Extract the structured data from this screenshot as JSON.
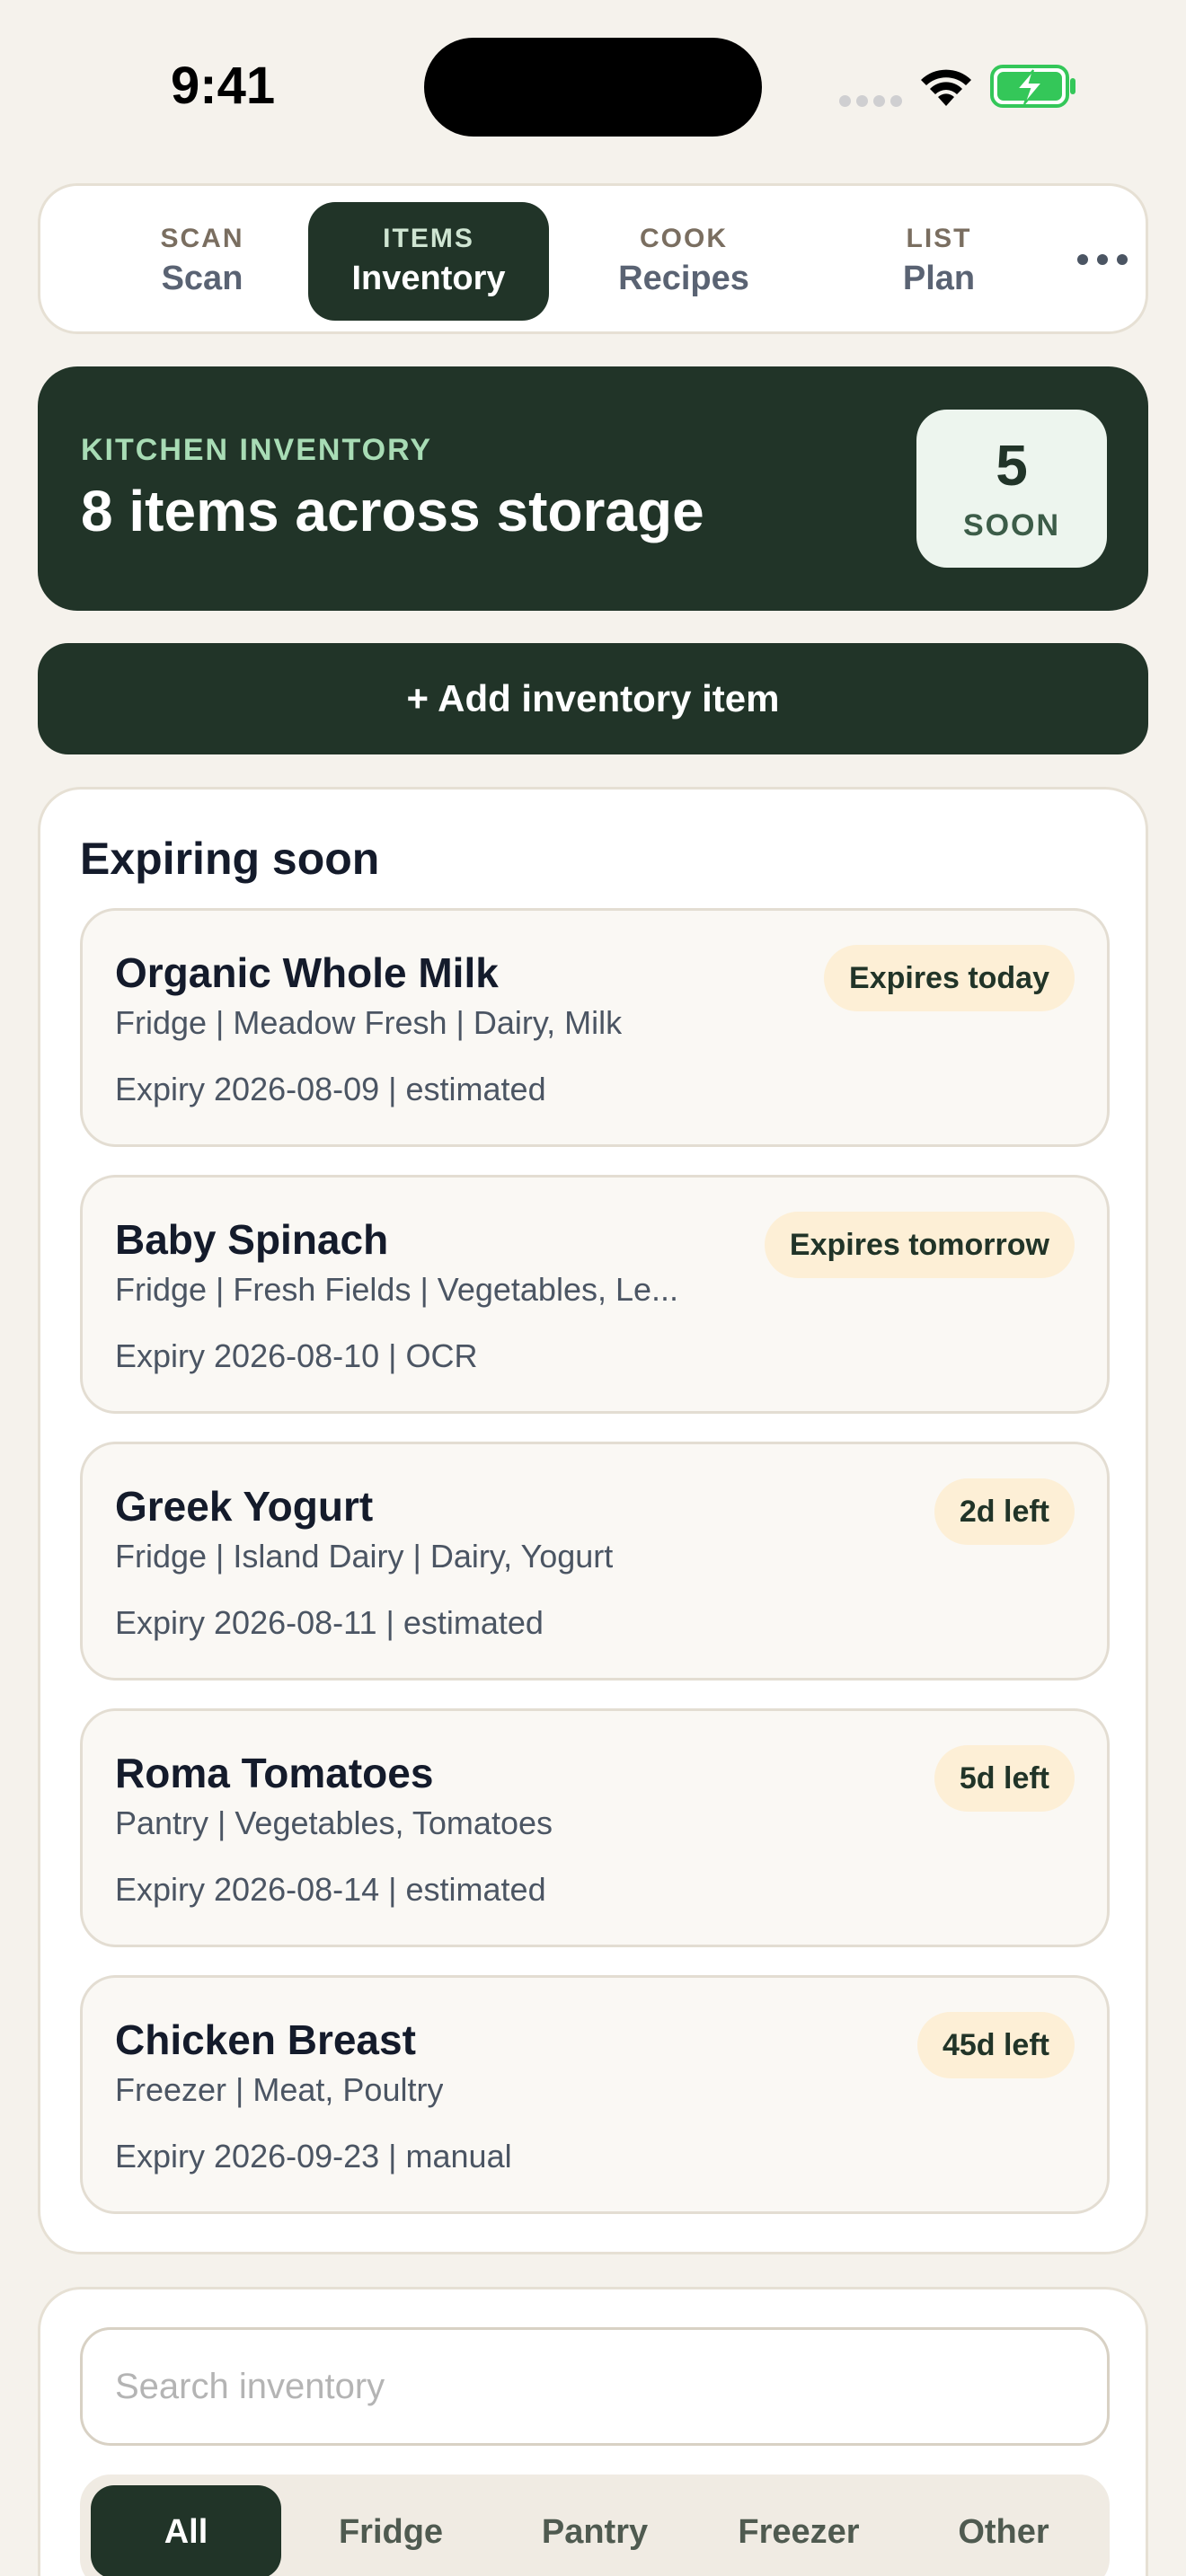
{
  "status_bar": {
    "time": "9:41",
    "icons": [
      "signal-icon",
      "wifi-icon",
      "battery-charging-icon"
    ]
  },
  "nav": {
    "tabs": [
      {
        "kicker": "SCAN",
        "label": "Scan",
        "active": false
      },
      {
        "kicker": "ITEMS",
        "label": "Inventory",
        "active": true
      },
      {
        "kicker": "COOK",
        "label": "Recipes",
        "active": false
      },
      {
        "kicker": "LIST",
        "label": "Plan",
        "active": false
      }
    ],
    "more_icon": "more-horizontal-icon"
  },
  "summary": {
    "kicker": "KITCHEN INVENTORY",
    "title": "8 items across storage",
    "soon_count": "5",
    "soon_label": "SOON"
  },
  "add_button": {
    "label": "+ Add inventory item"
  },
  "expiring": {
    "title": "Expiring soon",
    "items": [
      {
        "name": "Organic Whole Milk",
        "meta": "Fridge | Meadow Fresh | Dairy, Milk",
        "expiry": "Expiry 2026-08-09 | estimated",
        "badge": "Expires today"
      },
      {
        "name": "Baby Spinach",
        "meta": "Fridge | Fresh Fields | Vegetables, Le...",
        "expiry": "Expiry 2026-08-10 | OCR",
        "badge": "Expires tomorrow"
      },
      {
        "name": "Greek Yogurt",
        "meta": "Fridge | Island Dairy | Dairy, Yogurt",
        "expiry": "Expiry 2026-08-11 | estimated",
        "badge": "2d left"
      },
      {
        "name": "Roma Tomatoes",
        "meta": "Pantry | Vegetables, Tomatoes",
        "expiry": "Expiry 2026-08-14 | estimated",
        "badge": "5d left"
      },
      {
        "name": "Chicken Breast",
        "meta": "Freezer | Meat, Poultry",
        "expiry": "Expiry 2026-09-23 | manual",
        "badge": "45d left"
      }
    ]
  },
  "search": {
    "value": "",
    "placeholder": "Search inventory"
  },
  "filters": {
    "selected": "All",
    "options": [
      "All",
      "Fridge",
      "Pantry",
      "Freezer",
      "Other"
    ]
  },
  "colors": {
    "brand_dark": "#213428",
    "background": "#f5f2ec",
    "badge_bg": "#fdefd6",
    "soon_badge_bg": "#edf5ee",
    "kicker_green": "#a8dcb5"
  }
}
